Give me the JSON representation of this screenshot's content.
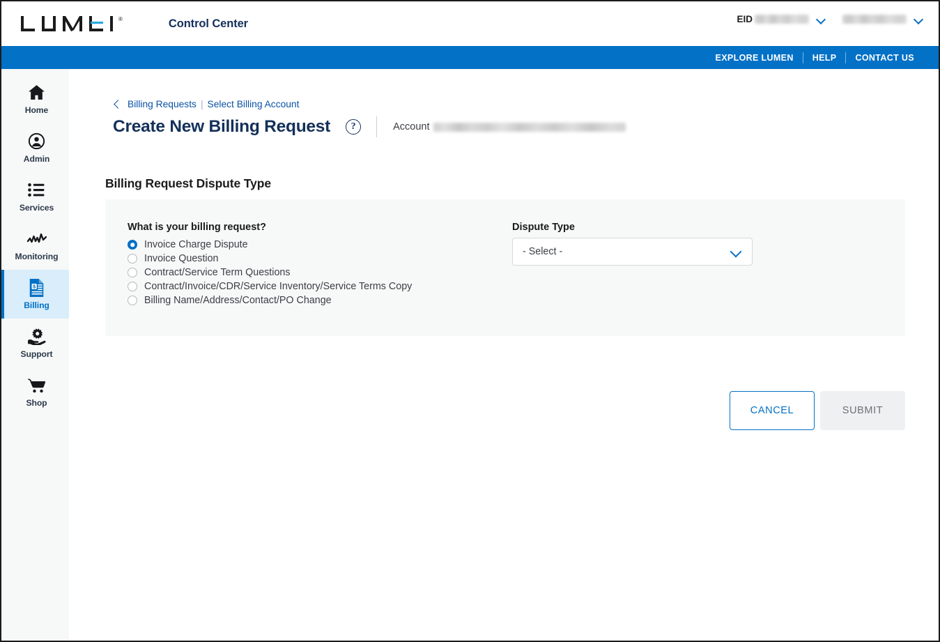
{
  "header": {
    "logo_text": "LUMEN",
    "logo_registered": "®",
    "app_name": "Control Center",
    "eid_label": "EID",
    "eid_value_redacted": "",
    "user_value_redacted": ""
  },
  "blue_nav": {
    "items": [
      {
        "label": "EXPLORE LUMEN",
        "name": "explore-lumen-link"
      },
      {
        "label": "HELP",
        "name": "help-link"
      },
      {
        "label": "CONTACT US",
        "name": "contact-us-link"
      }
    ]
  },
  "sidebar": {
    "items": [
      {
        "label": "Home",
        "icon": "home-icon",
        "active": false
      },
      {
        "label": "Admin",
        "icon": "user-circle-icon",
        "active": false
      },
      {
        "label": "Services",
        "icon": "list-icon",
        "active": false
      },
      {
        "label": "Monitoring",
        "icon": "waveform-icon",
        "active": false
      },
      {
        "label": "Billing",
        "icon": "invoice-dollar-icon",
        "active": true
      },
      {
        "label": "Support",
        "icon": "gear-hand-icon",
        "active": false
      },
      {
        "label": "Shop",
        "icon": "cart-icon",
        "active": false
      }
    ]
  },
  "breadcrumb": {
    "back_icon": "chevron-left-icon",
    "parent": "Billing Requests",
    "divider": "|",
    "current": "Select Billing Account"
  },
  "page": {
    "title": "Create New Billing Request",
    "help_icon_glyph": "?",
    "account_label": "Account",
    "account_value_redacted": ""
  },
  "form": {
    "section_title": "Billing Request Dispute Type",
    "question_label": "What is your billing request?",
    "radio_options": [
      {
        "label": "Invoice Charge Dispute",
        "selected": true
      },
      {
        "label": "Invoice Question",
        "selected": false
      },
      {
        "label": "Contract/Service Term Questions",
        "selected": false
      },
      {
        "label": "Contract/Invoice/CDR/Service Inventory/Service Terms Copy",
        "selected": false
      },
      {
        "label": "Billing Name/Address/Contact/PO Change",
        "selected": false
      }
    ],
    "dispute_type_label": "Dispute Type",
    "dispute_type_value": "- Select -",
    "dispute_type_chevron": "chevron-down-icon"
  },
  "actions": {
    "cancel_label": "CANCEL",
    "submit_label": "SUBMIT"
  },
  "colors": {
    "brand_blue": "#0271c6",
    "navy": "#14305a",
    "link_blue": "#0a52a5",
    "panel_gray": "#f7f8f8",
    "active_nav_bg": "#d9edfb",
    "disabled_btn_bg": "#eef0f1"
  }
}
